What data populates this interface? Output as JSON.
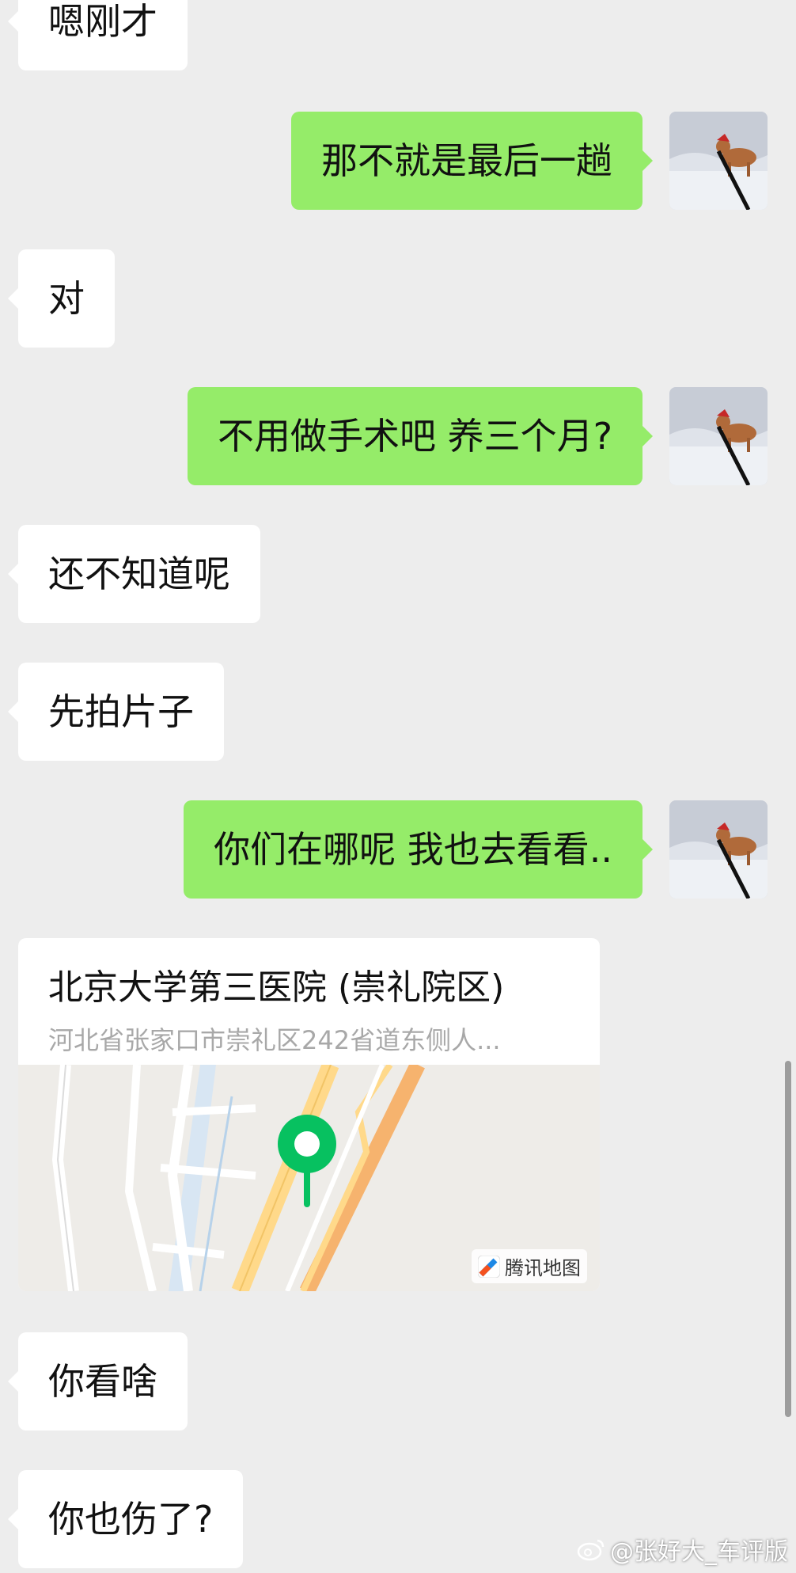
{
  "messages": [
    {
      "side": "in",
      "text": "嗯刚才"
    },
    {
      "side": "out",
      "text": "那不就是最后一趟"
    },
    {
      "side": "in",
      "text": "对"
    },
    {
      "side": "out",
      "text": "不用做手术吧 养三个月?"
    },
    {
      "side": "in",
      "text": "还不知道呢"
    },
    {
      "side": "in",
      "text": "先拍片子"
    },
    {
      "side": "out",
      "text": "你们在哪呢 我也去看看.."
    },
    {
      "side": "in",
      "text": "你看啥"
    },
    {
      "side": "in",
      "text": "你也伤了?"
    }
  ],
  "location": {
    "title": "北京大学第三医院 (崇礼院区)",
    "address": "河北省张家口市崇礼区242省道东侧人...",
    "map_brand": "腾讯地图"
  },
  "watermark": "@张好大_车评版",
  "colors": {
    "background": "#ededed",
    "incoming_bubble": "#ffffff",
    "outgoing_bubble": "#95ec69",
    "pin": "#07c160"
  }
}
